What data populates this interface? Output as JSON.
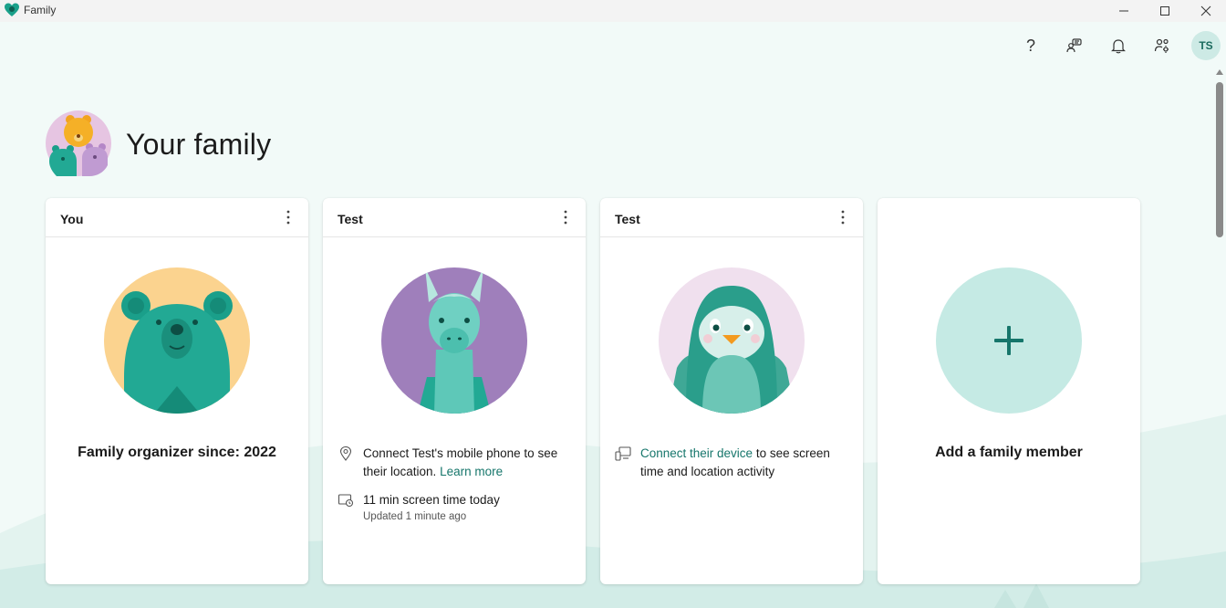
{
  "window": {
    "title": "Family"
  },
  "header": {
    "help_label": "?",
    "user_initials": "TS"
  },
  "page": {
    "title": "Your family"
  },
  "cards": [
    {
      "name": "You",
      "caption": "Family organizer since: 2022"
    },
    {
      "name": "Test",
      "location_text": "Connect Test's mobile phone to see their location.",
      "location_link": "Learn more",
      "screen_time": "11 min screen time today",
      "updated": "Updated 1 minute ago"
    },
    {
      "name": "Test",
      "device_link": "Connect their device",
      "device_text": "to see screen time and location activity"
    },
    {
      "caption": "Add a family member"
    }
  ],
  "colors": {
    "accent": "#16766b",
    "background": "#f2faf8",
    "avatar_bg": "#cdeae5"
  }
}
